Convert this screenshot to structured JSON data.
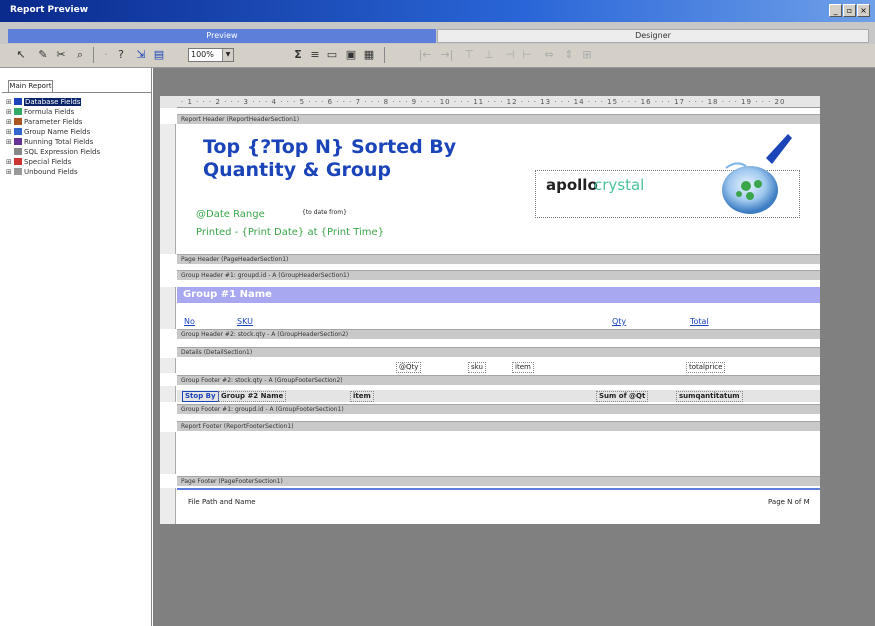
{
  "window": {
    "title": "Report Preview",
    "min": "_",
    "max": "▫",
    "close": "×"
  },
  "tabs": {
    "preview": "Preview",
    "design": "Designer"
  },
  "toolbar": {
    "zoom": "100%"
  },
  "left_panel": {
    "tab": "Main Report",
    "tree": [
      "Database Fields",
      "Formula Fields",
      "Parameter Fields",
      "Group Name Fields",
      "Running Total Fields",
      "SQL Expression Fields",
      "Special Fields",
      "Unbound Fields"
    ]
  },
  "ruler": "· 1 · · · 2 · · · 3 · · · 4 · · · 5 · · · 6 · · · 7 · · · 8 · · · 9 · · · 10 · · · 11 · · · 12 · · · 13 · · · 14 · · · 15 · · · 16 · · · 17 · · · 18 · · · 19 · · · 20",
  "bands": {
    "report_header": "Report Header (ReportHeaderSection1)",
    "page_header": "Page Header (PageHeaderSection1)",
    "group_header_1": "Group Header #1: groupd.id - A (GroupHeaderSection1)",
    "group_header_2": "Group Header #2: stock.qty - A (GroupHeaderSection2)",
    "details": "Details (DetailSection1)",
    "group_footer_2": "Group Footer #2: stock.qty - A (GroupFooterSection2)",
    "group_footer_1": "Group Footer #1: groupd.id - A (GroupFooterSection1)",
    "report_footer": "Report Footer (ReportFooterSection1)",
    "page_footer": "Page Footer (PageFooterSection1)"
  },
  "report": {
    "title": "Top {?Top N}  Sorted By Quantity & Group",
    "date_range_label": "@Date Range",
    "date_range_value": "{to date from}",
    "printed": "Printed - {Print Date} at  {Print Time}",
    "apollo_word": "apollo",
    "crystal_word": "crystal",
    "group1_name": "Group #1 Name",
    "col_no": "No",
    "col_sku": "SKU",
    "col_qty": "Qty",
    "col_total": "Total",
    "detail_qty": "@Qty",
    "detail_sku": "sku",
    "detail_item": "item",
    "detail_total": "totalprice",
    "stop_by": "Stop By",
    "group2_name": "Group #2 Name",
    "gf_item": "item",
    "gf_sum": "Sum of @Qt",
    "gf_total": "sumqantitatum",
    "file_path": "File Path and Name",
    "page_n_of_m": "Page N of M"
  }
}
